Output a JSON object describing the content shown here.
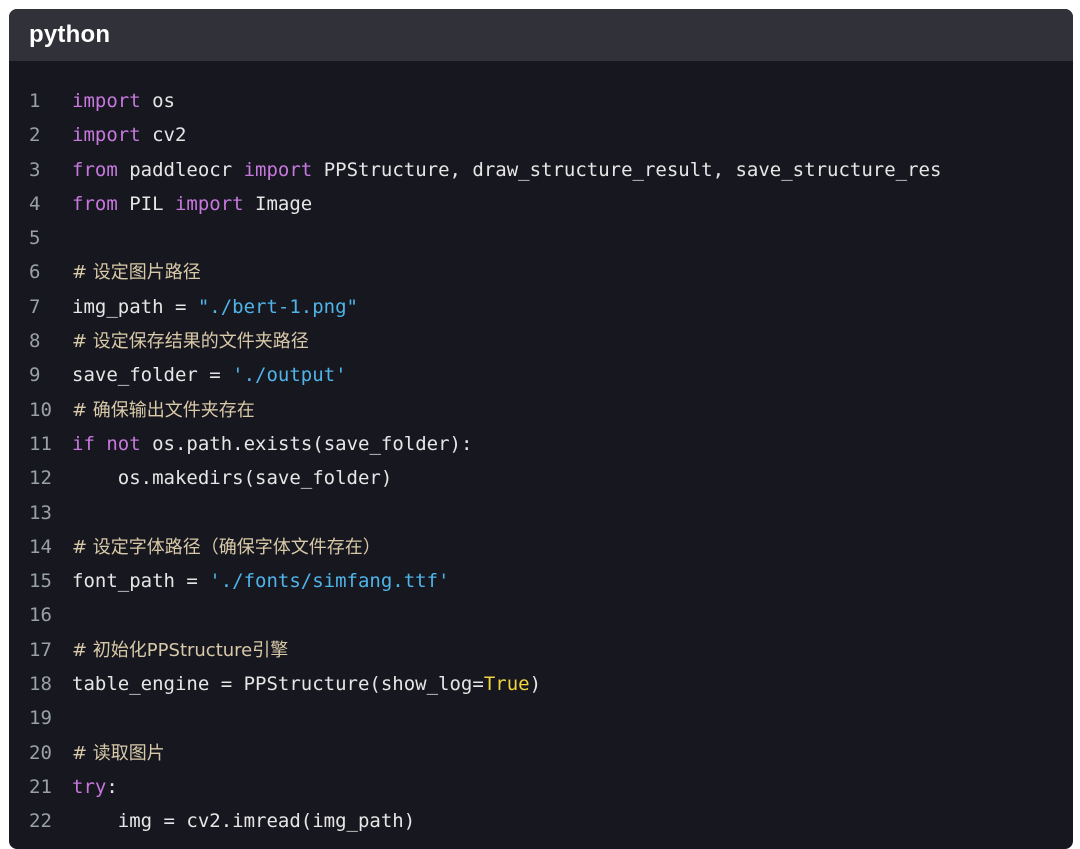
{
  "header": {
    "language": "python"
  },
  "lines": [
    {
      "number": "1",
      "tokens": [
        {
          "t": "import",
          "k": "keyword"
        },
        {
          "t": " os",
          "k": "plain"
        }
      ]
    },
    {
      "number": "2",
      "tokens": [
        {
          "t": "import",
          "k": "keyword"
        },
        {
          "t": " cv2",
          "k": "plain"
        }
      ]
    },
    {
      "number": "3",
      "tokens": [
        {
          "t": "from",
          "k": "keyword"
        },
        {
          "t": " paddleocr ",
          "k": "plain"
        },
        {
          "t": "import",
          "k": "keyword"
        },
        {
          "t": " PPStructure, draw_structure_result, save_structure_res",
          "k": "plain"
        }
      ]
    },
    {
      "number": "4",
      "tokens": [
        {
          "t": "from",
          "k": "keyword"
        },
        {
          "t": " PIL ",
          "k": "plain"
        },
        {
          "t": "import",
          "k": "keyword"
        },
        {
          "t": " Image",
          "k": "plain"
        }
      ]
    },
    {
      "number": "5",
      "tokens": []
    },
    {
      "number": "6",
      "tokens": [
        {
          "t": "# 设定图片路径",
          "k": "comment"
        }
      ]
    },
    {
      "number": "7",
      "tokens": [
        {
          "t": "img_path = ",
          "k": "plain"
        },
        {
          "t": "\"./bert-1.png\"",
          "k": "string"
        }
      ]
    },
    {
      "number": "8",
      "tokens": [
        {
          "t": "# 设定保存结果的文件夹路径",
          "k": "comment"
        }
      ]
    },
    {
      "number": "9",
      "tokens": [
        {
          "t": "save_folder = ",
          "k": "plain"
        },
        {
          "t": "'./output'",
          "k": "string"
        }
      ]
    },
    {
      "number": "10",
      "tokens": [
        {
          "t": "# 确保输出文件夹存在",
          "k": "comment"
        }
      ]
    },
    {
      "number": "11",
      "tokens": [
        {
          "t": "if",
          "k": "keyword"
        },
        {
          "t": " ",
          "k": "plain"
        },
        {
          "t": "not",
          "k": "keyword"
        },
        {
          "t": " os.path.exists(save_folder):",
          "k": "plain"
        }
      ]
    },
    {
      "number": "12",
      "tokens": [
        {
          "t": "    os.makedirs(save_folder)",
          "k": "plain"
        }
      ]
    },
    {
      "number": "13",
      "tokens": []
    },
    {
      "number": "14",
      "tokens": [
        {
          "t": "# 设定字体路径（确保字体文件存在）",
          "k": "comment"
        }
      ]
    },
    {
      "number": "15",
      "tokens": [
        {
          "t": "font_path = ",
          "k": "plain"
        },
        {
          "t": "'./fonts/simfang.ttf'",
          "k": "string"
        }
      ]
    },
    {
      "number": "16",
      "tokens": []
    },
    {
      "number": "17",
      "tokens": [
        {
          "t": "# 初始化PPStructure引擎",
          "k": "comment"
        }
      ]
    },
    {
      "number": "18",
      "tokens": [
        {
          "t": "table_engine = PPStructure(show_log=",
          "k": "plain"
        },
        {
          "t": "True",
          "k": "bool"
        },
        {
          "t": ")",
          "k": "plain"
        }
      ]
    },
    {
      "number": "19",
      "tokens": []
    },
    {
      "number": "20",
      "tokens": [
        {
          "t": "# 读取图片",
          "k": "comment"
        }
      ]
    },
    {
      "number": "21",
      "tokens": [
        {
          "t": "try",
          "k": "keyword"
        },
        {
          "t": ":",
          "k": "plain"
        }
      ]
    },
    {
      "number": "22",
      "tokens": [
        {
          "t": "    img = cv2.imread(img_path)",
          "k": "plain"
        }
      ]
    }
  ]
}
